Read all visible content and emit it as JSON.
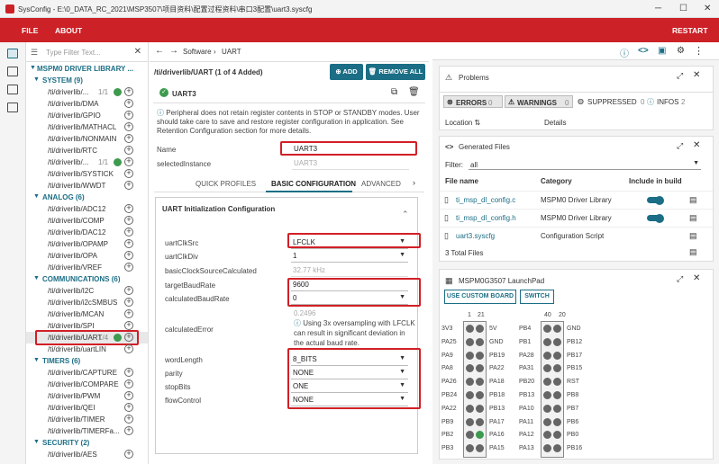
{
  "titlebar": {
    "title": "SysConfig - E:\\0_DATA_RC_2021\\MSP3507\\项目资料\\配置过程资料\\串口3配置\\uart3.syscfg",
    "min": "─",
    "max": "☐",
    "close": "✕"
  },
  "menu": {
    "file": "FILE",
    "about": "ABOUT",
    "restart": "RESTART"
  },
  "tree": {
    "filter_placeholder": "Type Filter Text...",
    "root": "MSPM0 DRIVER LIBRARY ...",
    "groups": [
      {
        "label": "SYSTEM (9)",
        "items": [
          {
            "label": "/ti/driverlib/...",
            "count": "1/1",
            "added": true
          },
          {
            "label": "/ti/driverlib/DMA"
          },
          {
            "label": "/ti/driverlib/GPIO"
          },
          {
            "label": "/ti/driverlib/MATHACL"
          },
          {
            "label": "/ti/driverlib/NONMAIN"
          },
          {
            "label": "/ti/driverlib/RTC"
          },
          {
            "label": "/ti/driverlib/...",
            "count": "1/1",
            "added": true
          },
          {
            "label": "/ti/driverlib/SYSTICK"
          },
          {
            "label": "/ti/driverlib/WWDT"
          }
        ]
      },
      {
        "label": "ANALOG (6)",
        "items": [
          {
            "label": "/ti/driverlib/ADC12"
          },
          {
            "label": "/ti/driverlib/COMP"
          },
          {
            "label": "/ti/driverlib/DAC12"
          },
          {
            "label": "/ti/driverlib/OPAMP"
          },
          {
            "label": "/ti/driverlib/OPA"
          },
          {
            "label": "/ti/driverlib/VREF"
          }
        ]
      },
      {
        "label": "COMMUNICATIONS (6)",
        "items": [
          {
            "label": "/ti/driverlib/I2C"
          },
          {
            "label": "/ti/driverlib/i2cSMBUS"
          },
          {
            "label": "/ti/driverlib/MCAN"
          },
          {
            "label": "/ti/driverlib/SPI"
          },
          {
            "label": "/ti/driverlib/UART",
            "count": "1/4",
            "added": true,
            "selected": true
          },
          {
            "label": "/ti/driverlib/uartLIN"
          }
        ]
      },
      {
        "label": "TIMERS (6)",
        "items": [
          {
            "label": "/ti/driverlib/CAPTURE"
          },
          {
            "label": "/ti/driverlib/COMPARE"
          },
          {
            "label": "/ti/driverlib/PWM"
          },
          {
            "label": "/ti/driverlib/QEI"
          },
          {
            "label": "/ti/driverlib/TIMER"
          },
          {
            "label": "/ti/driverlib/TIMERFa..."
          }
        ]
      },
      {
        "label": "SECURITY (2)",
        "items": [
          {
            "label": "/ti/driverlib/AES"
          }
        ]
      }
    ]
  },
  "main": {
    "breadcrumb": {
      "software": "Software",
      "sep": "›",
      "uart": "UART"
    },
    "header": "/ti/driverlib/UART (1 of 4 Added)",
    "add_label": "ADD",
    "remove_all_label": "REMOVE ALL",
    "instance_name": "UART3",
    "notice": "Peripheral does not retain register contents in STOP or STANDBY modes. User should take care to save and restore register configuration in application. See Retention Configuration section for more details.",
    "name_label": "Name",
    "name_value": "UART3",
    "selected_instance_label": "selectedInstance",
    "selected_instance_value": "UART3",
    "tabs": [
      "QUICK PROFILES",
      "BASIC CONFIGURATION",
      "ADVANCED C"
    ],
    "section_title": "UART Initialization Configuration",
    "fields": {
      "clksrc": {
        "label": "uartClkSrc",
        "value": "LFCLK"
      },
      "clkdiv": {
        "label": "uartClkDiv",
        "value": "1"
      },
      "basicclk": {
        "label": "basicClockSourceCalculated",
        "value": "32.77 kHz"
      },
      "baud": {
        "label": "targetBaudRate",
        "value": "9600"
      },
      "calcbaud": {
        "label": "calculatedBaudRate",
        "value": "0"
      },
      "err_value": "0.2496",
      "err_label": "calculatedError",
      "err_note": "Using 3x oversampling with LFCLK can result in significant deviation in the actual baud rate.",
      "wordlen": {
        "label": "wordLength",
        "value": "8_BITS"
      },
      "parity": {
        "label": "parity",
        "value": "NONE"
      },
      "stopbits": {
        "label": "stopBits",
        "value": "ONE"
      },
      "flow": {
        "label": "flowControl",
        "value": "NONE"
      }
    }
  },
  "problems": {
    "title": "Problems",
    "errors": "ERRORS",
    "errors_n": "0",
    "warnings": "WARNINGS",
    "warnings_n": "0",
    "suppressed": "SUPPRESSED",
    "suppressed_n": "0",
    "infos": "INFOS",
    "infos_n": "2",
    "col_location": "Location",
    "col_details": "Details"
  },
  "files": {
    "title": "Generated Files",
    "filter_label": "Filter:",
    "filter_value": "all",
    "col_name": "File name",
    "col_cat": "Category",
    "col_build": "Include in build",
    "rows": [
      {
        "name": "ti_msp_dl_config.c",
        "cat": "MSPM0 Driver Library"
      },
      {
        "name": "ti_msp_dl_config.h",
        "cat": "MSPM0 Driver Library"
      },
      {
        "name": "uart3.syscfg",
        "cat": "Configuration Script"
      }
    ],
    "total": "3 Total Files"
  },
  "launchpad": {
    "title": "MSPM0G3507 LaunchPad",
    "custom_board": "USE CUSTOM BOARD",
    "switch": "SWITCH",
    "hdr_left": [
      "1",
      "21"
    ],
    "hdr_right": [
      "40",
      "20"
    ],
    "left_outer": [
      "3V3",
      "PA25",
      "PA9",
      "PA8",
      "PA26",
      "PB24",
      "PA22",
      "PB9",
      "PB2",
      "PB3"
    ],
    "left_inner": [
      "5V",
      "GND",
      "PB19",
      "PA22",
      "PA18",
      "PB18",
      "PB13",
      "PA17",
      "PA16",
      "PA15"
    ],
    "right_inner": [
      "PB4",
      "PB1",
      "PA28",
      "PA31",
      "PB20",
      "PB13",
      "PA10",
      "PA11",
      "PA12",
      "PA13"
    ],
    "right_outer": [
      "GND",
      "PB12",
      "PB17",
      "PB15",
      "RST",
      "PB8",
      "PB7",
      "PB6",
      "PB0",
      "PB16"
    ]
  }
}
